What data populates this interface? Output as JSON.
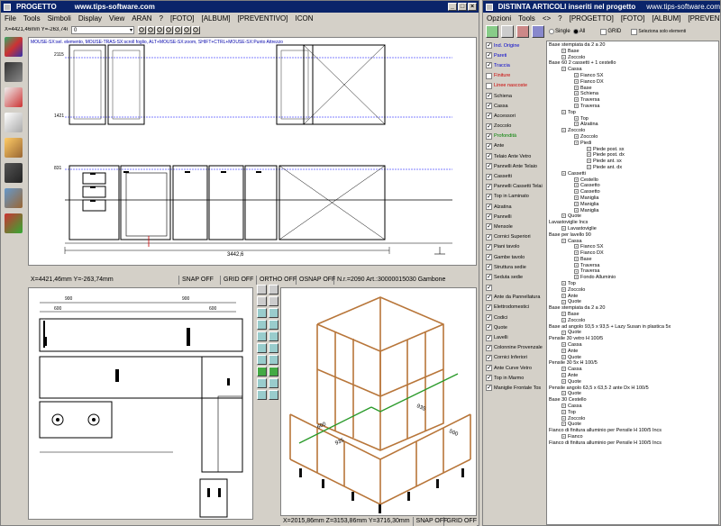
{
  "left_window": {
    "title": "PROGETTO",
    "site": "www.tips-software.com",
    "menu": [
      "File",
      "Tools",
      "Simboli",
      "Display",
      "View",
      "ARAN",
      "?",
      "[FOTO]",
      "[ALBUM]",
      "[PREVENTIVO]",
      "ICON"
    ],
    "coords_bar": "X=4421,46mm  Y=-263,74mm",
    "hint_bar": "MOUSE-SX:sel. elemento, MOUSE-TRAS-SX:scroll foglio, ALT+MOUSE-SX:zoom, SHIFT+CTRL+MOUSE-SX:Punto Attrezzo",
    "layer_value": "0",
    "dimension_total": "3442,6",
    "side_dims": [
      "2115",
      "1421",
      "831"
    ],
    "plan_dims": [
      "900",
      "900",
      "1080",
      "2200",
      "600",
      "600"
    ],
    "status_top": {
      "coords": "X=4421,46mm  Y=-263,74mm",
      "snap": "SNAP OFF",
      "grid": "GRID OFF",
      "ortho": "ORTHO OFF",
      "osnap": "OSNAP OFF",
      "info": "N.r.=2090 Art.:30000015030 Gambone"
    },
    "status_bottom": {
      "coords": "X=2015,86mm  Z=3153,86mm  Y=3716,30mm",
      "snap": "SNAP OFF",
      "grid": "GRID OFF"
    },
    "iso_labels": [
      "600",
      "935",
      "935",
      "500"
    ]
  },
  "right_window": {
    "title": "DISTINTA ARTICOLI inseriti nel progetto",
    "site": "www.tips-software.com",
    "menu": [
      "Opzioni",
      "Tools",
      "<>",
      "?",
      "[PROGETTO]",
      "[FOTO]",
      "[ALBUM]",
      "[PREVENTIVO]",
      "ICON"
    ],
    "single_label": "Single",
    "all_label": "All",
    "grid_label": "GRID",
    "select_label": "Seleziona solo elementi",
    "layers": [
      {
        "label": "Ind. Origine",
        "checked": true,
        "color": "#0000cc"
      },
      {
        "label": "Pareti",
        "checked": true,
        "color": "#0000cc"
      },
      {
        "label": "Traccia",
        "checked": true,
        "color": "#0000cc"
      },
      {
        "label": "Finiture",
        "checked": false,
        "color": "#cc0000"
      },
      {
        "label": "Linee nascoste",
        "checked": false,
        "color": "#cc0000"
      },
      {
        "label": "Schiena",
        "checked": true,
        "color": "#000000"
      },
      {
        "label": "Cassa",
        "checked": true,
        "color": "#000000"
      },
      {
        "label": "Accessori",
        "checked": true,
        "color": "#000000"
      },
      {
        "label": "Zoccolo",
        "checked": true,
        "color": "#000000"
      },
      {
        "label": "Profondità",
        "checked": true,
        "color": "#008000"
      },
      {
        "label": "Ante",
        "checked": true,
        "color": "#000000"
      },
      {
        "label": "Telaio Ante Vetro",
        "checked": true,
        "color": "#000000"
      },
      {
        "label": "Pannelli Ante Telaio",
        "checked": true,
        "color": "#000000"
      },
      {
        "label": "Cassetti",
        "checked": true,
        "color": "#000000"
      },
      {
        "label": "Pannelli Cassetti Telai",
        "checked": true,
        "color": "#000000"
      },
      {
        "label": "Top in Laminato",
        "checked": true,
        "color": "#000000"
      },
      {
        "label": "Alzatina",
        "checked": true,
        "color": "#000000"
      },
      {
        "label": "Pannelli",
        "checked": true,
        "color": "#000000"
      },
      {
        "label": "Mensole",
        "checked": true,
        "color": "#000000"
      },
      {
        "label": "Cornici Superiori",
        "checked": true,
        "color": "#000000"
      },
      {
        "label": "Piani tavolo",
        "checked": true,
        "color": "#000000"
      },
      {
        "label": "Gambe tavolo",
        "checked": true,
        "color": "#000000"
      },
      {
        "label": "Struttura sedie",
        "checked": true,
        "color": "#000000"
      },
      {
        "label": "Seduta sedie",
        "checked": true,
        "color": "#000000"
      },
      {
        "label": "",
        "checked": true,
        "color": "#000000"
      },
      {
        "label": "Ante da Pannellatura",
        "checked": true,
        "color": "#000000"
      },
      {
        "label": "Elettrodomestici",
        "checked": true,
        "color": "#000000"
      },
      {
        "label": "Codici",
        "checked": true,
        "color": "#000000"
      },
      {
        "label": "Quote",
        "checked": true,
        "color": "#000000"
      },
      {
        "label": "Lavelli",
        "checked": true,
        "color": "#000000"
      },
      {
        "label": "Colonnine Provenzale",
        "checked": true,
        "color": "#000000"
      },
      {
        "label": "Cornici Inferiori",
        "checked": true,
        "color": "#000000"
      },
      {
        "label": "Ante Curve Vetro",
        "checked": true,
        "color": "#000000"
      },
      {
        "label": "Top in Marmo",
        "checked": true,
        "color": "#000000"
      },
      {
        "label": "Maniglie Frontale Tos",
        "checked": true,
        "color": "#000000"
      }
    ],
    "tree": [
      {
        "d": 0,
        "t": "Base stempiata da 2 a 20"
      },
      {
        "d": 1,
        "t": "Base"
      },
      {
        "d": 1,
        "t": "Zoccolo"
      },
      {
        "d": 0,
        "t": "Base 60 2 cassetti + 1 cestello"
      },
      {
        "d": 1,
        "t": "Cassa"
      },
      {
        "d": 2,
        "t": "Fianco SX"
      },
      {
        "d": 2,
        "t": "Fianco DX"
      },
      {
        "d": 2,
        "t": "Base"
      },
      {
        "d": 2,
        "t": "Schiena"
      },
      {
        "d": 2,
        "t": "Traversa"
      },
      {
        "d": 2,
        "t": "Traversa"
      },
      {
        "d": 1,
        "t": "Top"
      },
      {
        "d": 2,
        "t": "Top"
      },
      {
        "d": 2,
        "t": "Alzatina"
      },
      {
        "d": 1,
        "t": "Zoccolo"
      },
      {
        "d": 2,
        "t": "Zoccolo"
      },
      {
        "d": 2,
        "t": "Piedi"
      },
      {
        "d": 3,
        "t": "Piede post. sx"
      },
      {
        "d": 3,
        "t": "Piede post. dx"
      },
      {
        "d": 3,
        "t": "Piede ant. sx"
      },
      {
        "d": 3,
        "t": "Piede ant. dx"
      },
      {
        "d": 1,
        "t": "Cassetti"
      },
      {
        "d": 2,
        "t": "Cestello"
      },
      {
        "d": 2,
        "t": "Cassetto"
      },
      {
        "d": 2,
        "t": "Cassetto"
      },
      {
        "d": 2,
        "t": "Maniglia"
      },
      {
        "d": 2,
        "t": "Maniglia"
      },
      {
        "d": 2,
        "t": "Maniglia"
      },
      {
        "d": 1,
        "t": "Quote"
      },
      {
        "d": 0,
        "t": "Lavastoviglie Incs"
      },
      {
        "d": 1,
        "t": "Lavastoviglie"
      },
      {
        "d": 0,
        "t": "Base per lavello 90"
      },
      {
        "d": 1,
        "t": "Cassa"
      },
      {
        "d": 2,
        "t": "Fianco SX"
      },
      {
        "d": 2,
        "t": "Fianco DX"
      },
      {
        "d": 2,
        "t": "Base"
      },
      {
        "d": 2,
        "t": "Traversa"
      },
      {
        "d": 2,
        "t": "Traversa"
      },
      {
        "d": 2,
        "t": "Fondo Alluminio"
      },
      {
        "d": 1,
        "t": "Top"
      },
      {
        "d": 1,
        "t": "Zoccolo"
      },
      {
        "d": 1,
        "t": "Ante"
      },
      {
        "d": 1,
        "t": "Quote"
      },
      {
        "d": 0,
        "t": "Base stempiata da 2 a 20"
      },
      {
        "d": 1,
        "t": "Base"
      },
      {
        "d": 1,
        "t": "Zoccolo"
      },
      {
        "d": 0,
        "t": "Base ad angolo 93,5 x 93,5 + Lazy Susan in plastica 5x"
      },
      {
        "d": 1,
        "t": "Quote"
      },
      {
        "d": 0,
        "t": "Pensile 30 vetro H 100/5"
      },
      {
        "d": 1,
        "t": "Cassa"
      },
      {
        "d": 1,
        "t": "Ante"
      },
      {
        "d": 1,
        "t": "Quote"
      },
      {
        "d": 0,
        "t": "Pensile 30 5x H 100/5"
      },
      {
        "d": 1,
        "t": "Cassa"
      },
      {
        "d": 1,
        "t": "Ante"
      },
      {
        "d": 1,
        "t": "Quote"
      },
      {
        "d": 0,
        "t": "Pensile angolo 63,5 x 63,5 2 ante Dx H 100/5"
      },
      {
        "d": 1,
        "t": "Quote"
      },
      {
        "d": 0,
        "t": "Base 30 Cestello"
      },
      {
        "d": 1,
        "t": "Cassa"
      },
      {
        "d": 1,
        "t": "Top"
      },
      {
        "d": 1,
        "t": "Zoccolo"
      },
      {
        "d": 1,
        "t": "Quote"
      },
      {
        "d": 0,
        "t": "Fianco di finitura alluminio per Pensile H 100/5 Incs"
      },
      {
        "d": 1,
        "t": "Fianco"
      },
      {
        "d": 0,
        "t": "Fianco di finitura alluminio per Pensile H 100/5 Incs"
      }
    ]
  }
}
